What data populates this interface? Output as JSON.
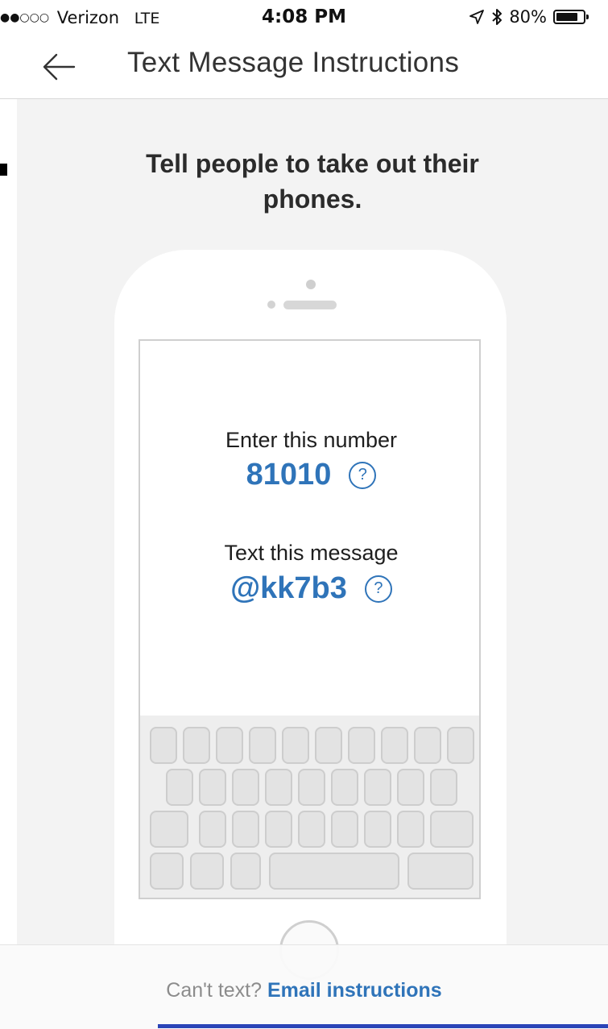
{
  "status_bar": {
    "signal": "●●○○○",
    "carrier": "Verizon",
    "network": "LTE",
    "time": "4:08 PM",
    "battery_percent": "80%",
    "battery_level": 0.8,
    "icons": [
      "location-icon",
      "bluetooth-icon",
      "battery-icon"
    ]
  },
  "header": {
    "title": "Text Message Instructions",
    "back_icon": "arrow-left-icon"
  },
  "main": {
    "instruction": "Tell people to take out their phones.",
    "enter_label": "Enter this number",
    "number": "81010",
    "message_label": "Text this message",
    "message": "@kk7b3",
    "help_glyph": "?"
  },
  "footer": {
    "prompt": "Can't text?",
    "link": "Email instructions"
  },
  "colors": {
    "accent": "#2f74b9",
    "background": "#f3f3f3",
    "muted_text": "#8c8c8c"
  }
}
